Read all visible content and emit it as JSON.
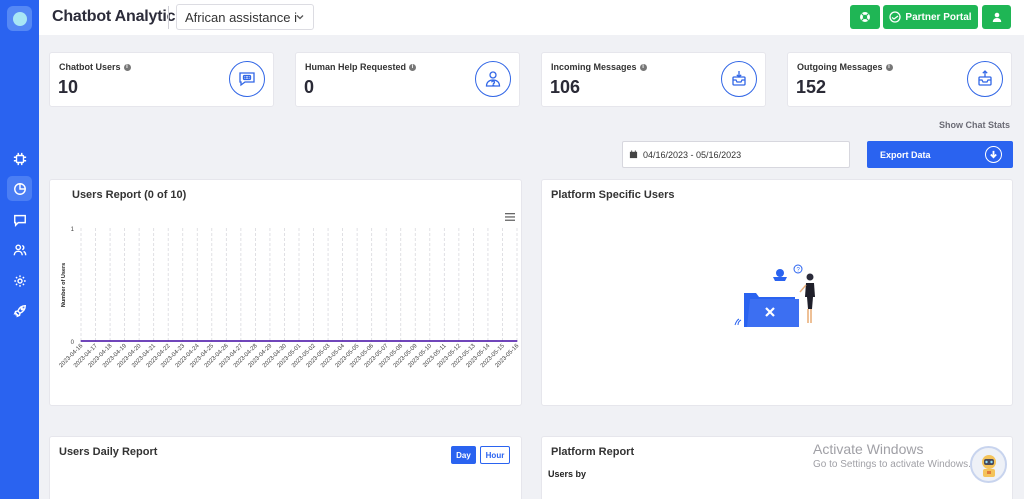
{
  "app": {
    "title": "Chatbot Analytics"
  },
  "header": {
    "bot_select": "African assistance i",
    "partner_portal_label": "Partner Portal"
  },
  "stats": [
    {
      "label": "Chatbot Users",
      "value": "10",
      "icon": "chatbot-icon"
    },
    {
      "label": "Human Help Requested",
      "value": "0",
      "icon": "human-help-icon"
    },
    {
      "label": "Incoming Messages",
      "value": "106",
      "icon": "inbox-in-icon"
    },
    {
      "label": "Outgoing Messages",
      "value": "152",
      "icon": "inbox-out-icon"
    }
  ],
  "show_chat_stats": "Show Chat Stats",
  "date_range": "04/16/2023 - 05/16/2023",
  "export_label": "Export Data",
  "users_report": {
    "title": "Users Report (0 of 10)",
    "ylabel": "Number of Users"
  },
  "platform_users": {
    "title": "Platform Specific Users"
  },
  "daily_report": {
    "title": "Users Daily Report",
    "day_label": "Day",
    "hour_label": "Hour"
  },
  "platform_report": {
    "title": "Platform Report",
    "subtitle": "Users by"
  },
  "watermark": {
    "line1": "Activate Windows",
    "line2": "Go to Settings to activate Windows."
  },
  "colors": {
    "brand_blue": "#2a63f0",
    "success_green": "#1fb655",
    "line_purple": "#5b2bb0"
  },
  "chart_data": {
    "type": "line",
    "title": "Users Report (0 of 10)",
    "xlabel": "",
    "ylabel": "Number of Users",
    "x": [
      "2023-04-16",
      "2023-04-17",
      "2023-04-18",
      "2023-04-19",
      "2023-04-20",
      "2023-04-21",
      "2023-04-22",
      "2023-04-23",
      "2023-04-24",
      "2023-04-25",
      "2023-04-26",
      "2023-04-27",
      "2023-04-28",
      "2023-04-29",
      "2023-04-30",
      "2023-05-01",
      "2023-05-02",
      "2023-05-03",
      "2023-05-04",
      "2023-05-05",
      "2023-05-06",
      "2023-05-07",
      "2023-05-08",
      "2023-05-09",
      "2023-05-10",
      "2023-05-11",
      "2023-05-12",
      "2023-05-13",
      "2023-05-14",
      "2023-05-15",
      "2023-05-16"
    ],
    "series": [
      {
        "values": [
          0,
          0,
          0,
          0,
          0,
          0,
          0,
          0,
          0,
          0,
          0,
          0,
          0,
          0,
          0,
          0,
          0,
          0,
          0,
          0,
          0,
          0,
          0,
          0,
          0,
          0,
          0,
          0,
          0,
          0,
          0
        ]
      }
    ],
    "yticks": [
      "0",
      "1"
    ],
    "ylim": [
      0,
      1
    ],
    "grid": true
  }
}
